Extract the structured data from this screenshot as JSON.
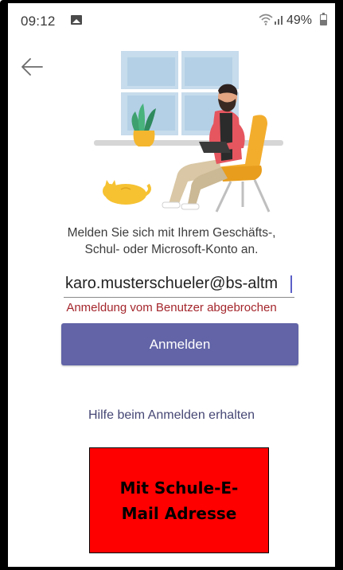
{
  "status_bar": {
    "time": "09:12",
    "battery_percent": "49%",
    "battery_level": 0.49,
    "icons": [
      "gallery-icon",
      "wifi-icon",
      "signal-icon",
      "battery-icon"
    ]
  },
  "navigation": {
    "back_icon": "arrow-left-icon"
  },
  "signin": {
    "prompt_line1": "Melden Sie sich mit Ihrem Geschäfts-,",
    "prompt_line2": "Schul- oder Microsoft-Konto an.",
    "email_value": "karo.musterschueler@bs-altm",
    "error_message": "Anmeldung vom Benutzer abgebrochen",
    "button_label": "Anmelden",
    "help_link": "Hilfe beim Anmelden erhalten"
  },
  "annotation": {
    "line1": "Mit Schule-E-",
    "line2": "Mail Adresse"
  },
  "colors": {
    "accent": "#6264a7",
    "error": "#a4262c",
    "link": "#464775",
    "annotation_bg": "#ff0000"
  }
}
